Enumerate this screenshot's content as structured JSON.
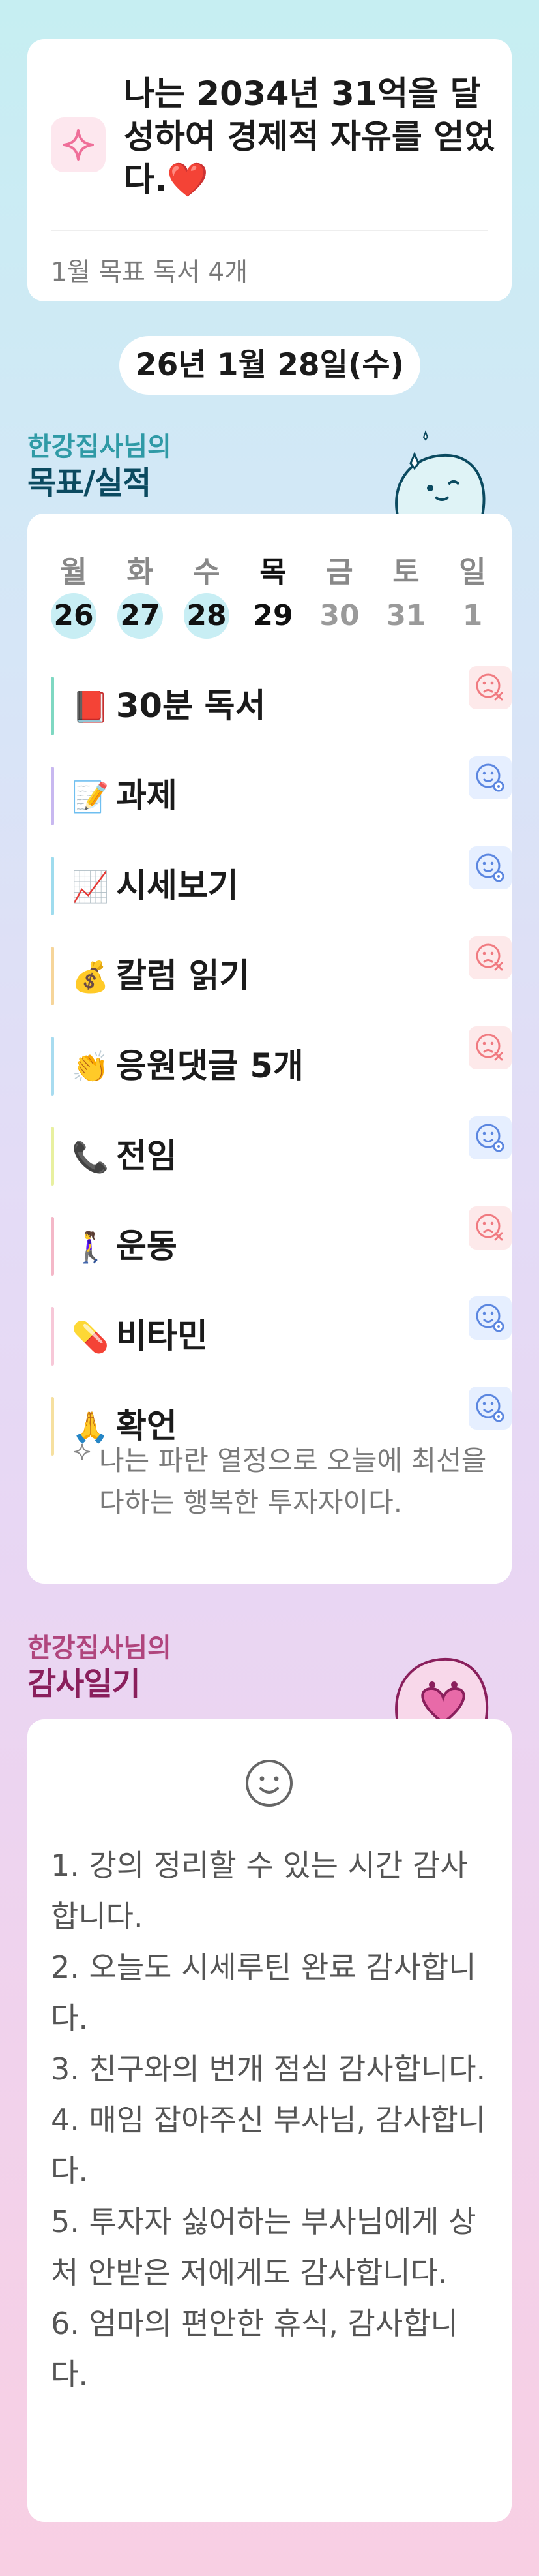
{
  "goal": {
    "text": "나는 2034년 31억을 달성하여 경제적 자유를 얻었다.❤️",
    "sub": "1월 목표 독서 4개",
    "icon": "sparkle-icon"
  },
  "date": "26년 1월 28일(수)",
  "goals_section": {
    "owner": "한강집사님의",
    "title": "목표/실적"
  },
  "week": [
    {
      "name": "월",
      "num": "26",
      "state": "done"
    },
    {
      "name": "화",
      "num": "27",
      "state": "done"
    },
    {
      "name": "수",
      "num": "28",
      "state": "done"
    },
    {
      "name": "목",
      "num": "29",
      "state": "today"
    },
    {
      "name": "금",
      "num": "30",
      "state": "future"
    },
    {
      "name": "토",
      "num": "31",
      "state": "future"
    },
    {
      "name": "일",
      "num": "1",
      "state": "future"
    }
  ],
  "tasks": [
    {
      "emoji": "📕",
      "label": "30분 독서",
      "status": "fail",
      "bar": "#7fd8c2"
    },
    {
      "emoji": "📝",
      "label": "과제",
      "status": "ok",
      "bar": "#c8b8f0"
    },
    {
      "emoji": "📈",
      "label": "시세보기",
      "status": "ok",
      "bar": "#9fdcee"
    },
    {
      "emoji": "💰",
      "label": "칼럼 읽기",
      "status": "fail",
      "bar": "#f6d59a"
    },
    {
      "emoji": "👏",
      "label": "응원댓글 5개",
      "status": "fail",
      "bar": "#a8dcf0"
    },
    {
      "emoji": "📞",
      "label": "전임",
      "status": "ok",
      "bar": "#e8f0a0"
    },
    {
      "emoji": "🚶‍♀️",
      "label": "운동",
      "status": "fail",
      "bar": "#f4b8c8"
    },
    {
      "emoji": "💊",
      "label": "비타민",
      "status": "ok",
      "bar": "#f7c8d8"
    },
    {
      "emoji": "🙏",
      "label": "확언",
      "status": "ok",
      "bar": "#f6e0a0"
    }
  ],
  "affirmation": "나는 파란 열정으로 오늘에 최선을 다하는 행복한 투자자이다.",
  "gratitude_section": {
    "owner": "한강집사님의",
    "title": "감사일기"
  },
  "gratitude": [
    "1. 강의 정리할 수 있는 시간 감사합니다.",
    "2. 오늘도 시세루틴 완료 감사합니다.",
    "3. 친구와의 번개 점심 감사합니다.",
    "4. 매임 잡아주신 부사님, 감사합니다.",
    "5. 투자자 싫어하는 부사님에게 상처 안받은 저에게도 감사합니다.",
    "6. 엄마의 편안한 휴식, 감사합니다."
  ],
  "colors": {
    "fail": "#f07a80",
    "ok": "#5b86e0",
    "accent": "#2f9aa6"
  }
}
